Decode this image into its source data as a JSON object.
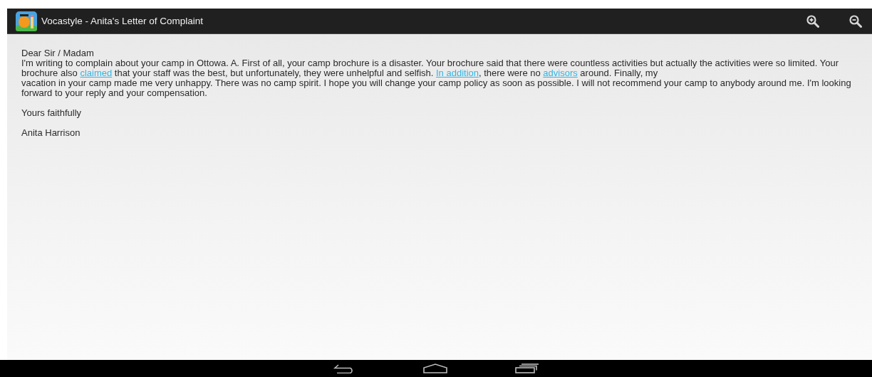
{
  "window": {
    "title": "Vocastyle - Anita's Letter of Complaint"
  },
  "toolbar": {
    "actions": [
      {
        "kind": "zoom-in"
      },
      {
        "kind": "zoom-out"
      }
    ]
  },
  "letter": {
    "salutation": "Dear Sir / Madam",
    "body": [
      {
        "kind": "text",
        "text": "I'm writing to complain about your camp in Ottowa. A. First of all, your camp brochure is a disaster. Your brochure said that there were countless activities but actually the activities were so limited. Your brochure also "
      },
      {
        "kind": "link",
        "text": "claimed"
      },
      {
        "kind": "text",
        "text": " that your staff was the best, but unfortunately, they were unhelpful and selfish. "
      },
      {
        "kind": "link",
        "text": "In addition"
      },
      {
        "kind": "text",
        "text": ", there were no "
      },
      {
        "kind": "link",
        "text": "advisors"
      },
      {
        "kind": "text",
        "text": " around. Finally, my"
      },
      {
        "kind": "break"
      },
      {
        "kind": "text",
        "text": "vacation in your camp made me very unhappy. There was no camp spirit. I hope you will change your camp policy as soon as possible. I will not recommend your camp to anybody around me. I'm looking forward to your reply and your compensation."
      }
    ],
    "closing": "Yours faithfully",
    "signature": "Anita Harrison"
  },
  "nav_bar": {
    "buttons": [
      {
        "kind": "back"
      },
      {
        "kind": "home"
      },
      {
        "kind": "recents"
      }
    ]
  }
}
